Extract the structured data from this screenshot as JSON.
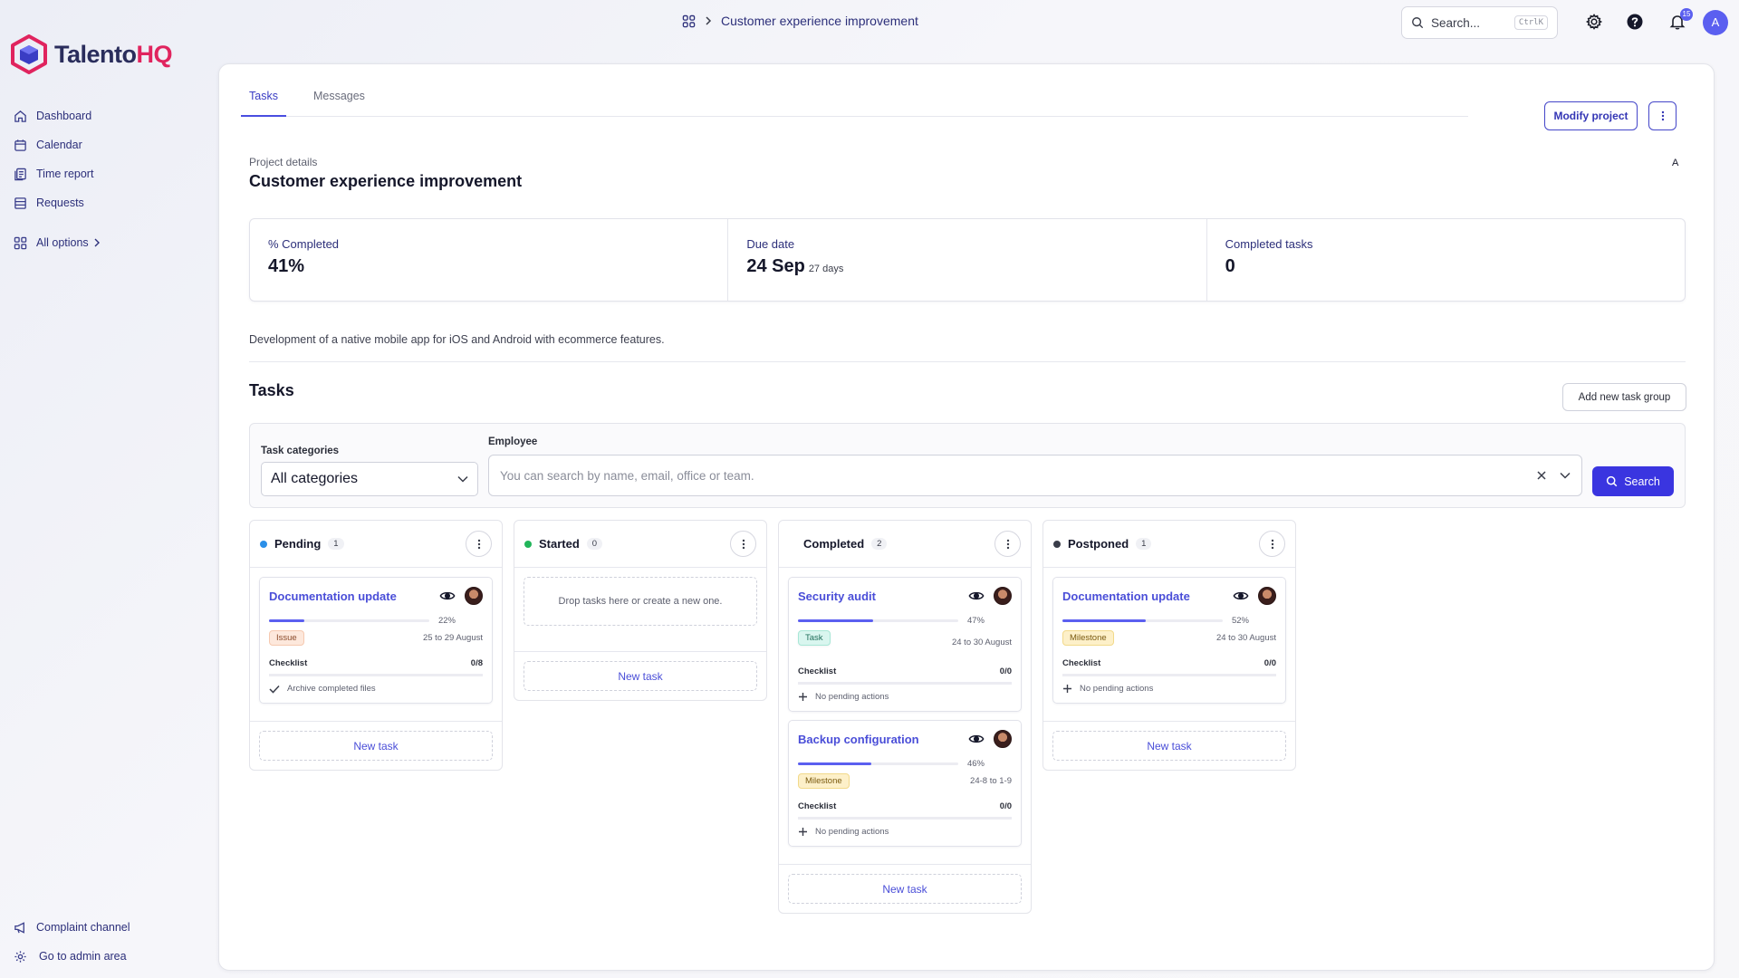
{
  "brand": {
    "name_main": "Talento",
    "name_accent": "HQ"
  },
  "sidebar": {
    "items": [
      {
        "label": "Dashboard",
        "icon": "home-icon"
      },
      {
        "label": "Calendar",
        "icon": "calendar-icon"
      },
      {
        "label": "Time report",
        "icon": "report-icon"
      },
      {
        "label": "Requests",
        "icon": "list-icon"
      }
    ],
    "all_options": "All options",
    "bottom": [
      {
        "label": "Complaint channel",
        "icon": "megaphone-icon"
      },
      {
        "label": "Go to admin area",
        "icon": "gear-icon"
      }
    ]
  },
  "topbar": {
    "breadcrumb": "Customer experience improvement",
    "search_placeholder": "Search...",
    "search_shortcut": "CtrlK",
    "notifications_count": "15",
    "avatar_initial": "A"
  },
  "tabs": [
    {
      "label": "Tasks",
      "active": true
    },
    {
      "label": "Messages",
      "active": false
    }
  ],
  "actions": {
    "modify_project": "Modify project"
  },
  "project": {
    "details_label": "Project details",
    "title": "Customer experience improvement",
    "assignee_initial": "A",
    "description": "Development of a native mobile app for iOS and Android with ecommerce features."
  },
  "stats": [
    {
      "label": "% Completed",
      "value": "41%",
      "sub": ""
    },
    {
      "label": "Due date",
      "value": "24 Sep",
      "sub": "27 days"
    },
    {
      "label": "Completed tasks",
      "value": "0",
      "sub": ""
    }
  ],
  "tasks_section": {
    "heading": "Tasks",
    "add_group": "Add new task group",
    "filters": {
      "categories_label": "Task categories",
      "categories_value": "All categories",
      "employee_label": "Employee",
      "employee_placeholder": "You can search by name, email, office or team.",
      "search_button": "Search"
    }
  },
  "columns": [
    {
      "title": "Pending",
      "count": "1",
      "dot_color": "#2b8fe8",
      "tasks": [
        {
          "title": "Documentation update",
          "progress": 0.22,
          "pct": "22%",
          "tag": "Issue",
          "tag_kind": "issue",
          "dates": "25 to 29 August",
          "checklist_label": "Checklist",
          "checklist_value": "0/8",
          "item": "Archive completed files",
          "item_icon": "check-icon"
        }
      ],
      "drop_text": "",
      "new_task": "New task"
    },
    {
      "title": "Started",
      "count": "0",
      "dot_color": "#22b55a",
      "tasks": [],
      "drop_text": "Drop tasks here or create a new one.",
      "new_task": "New task"
    },
    {
      "title": "Completed",
      "count": "2",
      "dot_color": "",
      "tasks": [
        {
          "title": "Security audit",
          "progress": 0.47,
          "pct": "47%",
          "tag": "Task",
          "tag_kind": "task",
          "dates": "24 to 30 August",
          "checklist_label": "Checklist",
          "checklist_value": "0/0",
          "item": "No pending actions",
          "item_icon": "plus-icon"
        },
        {
          "title": "Backup configuration",
          "progress": 0.46,
          "pct": "46%",
          "tag": "Milestone",
          "tag_kind": "milestone",
          "dates": "24-8 to 1-9",
          "checklist_label": "Checklist",
          "checklist_value": "0/0",
          "item": "No pending actions",
          "item_icon": "plus-icon"
        }
      ],
      "drop_text": "",
      "new_task": "New task"
    },
    {
      "title": "Postponed",
      "count": "1",
      "dot_color": "#3a3d4a",
      "tasks": [
        {
          "title": "Documentation update",
          "progress": 0.52,
          "pct": "52%",
          "tag": "Milestone",
          "tag_kind": "milestone",
          "dates": "24 to 30 August",
          "checklist_label": "Checklist",
          "checklist_value": "0/0",
          "item": "No pending actions",
          "item_icon": "plus-icon"
        }
      ],
      "drop_text": "",
      "new_task": "New task"
    }
  ]
}
